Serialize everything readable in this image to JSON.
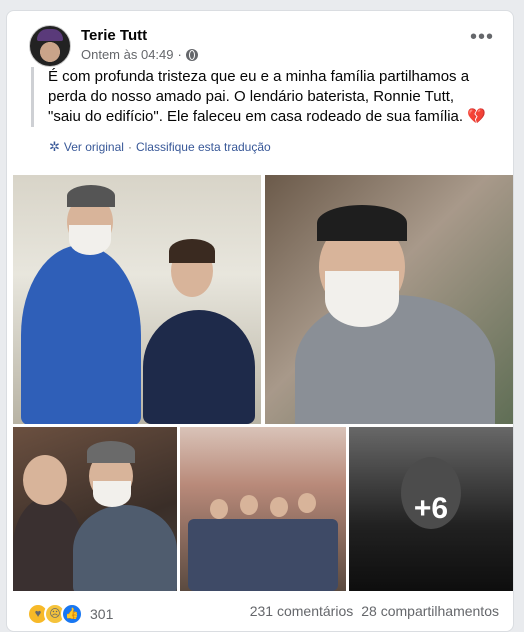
{
  "post": {
    "author": "Terie Tutt",
    "timestamp": "Ontem às 04:49",
    "more_label": "•••",
    "text": "É com profunda tristeza que eu e a minha família partilhamos a perda do nosso amado pai. O lendário baterista, Ronnie Tutt, \"saiu do edifício\". Ele faleceu em casa rodeado de sua família.",
    "emoji": "💔",
    "translation": {
      "see_original": "Ver original",
      "separator": "·",
      "rate": "Classifique esta tradução"
    }
  },
  "photos": {
    "extra_count": "+6"
  },
  "footer": {
    "reaction_count": "301",
    "comments": "231 comentários",
    "shares": "28 compartilhamentos"
  },
  "icons": {
    "privacy": "globe-icon",
    "translation": "gear-icon",
    "reactions": [
      "care-icon",
      "sad-icon",
      "like-icon"
    ]
  }
}
